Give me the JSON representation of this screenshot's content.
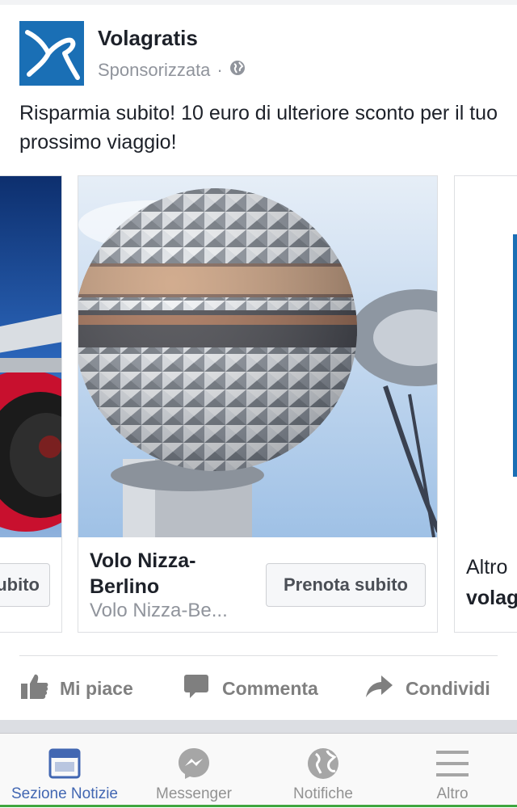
{
  "post": {
    "page_name": "Volagratis",
    "sponsored": "Sponsorizzata",
    "separator": "·",
    "text": "Risparmia subito! 10 euro di ulteriore sconto per il tuo prossimo viaggio!"
  },
  "carousel": {
    "left_card": {
      "cta": "ubito"
    },
    "main_card": {
      "title": "Volo Nizza-Berlino",
      "subtitle": "Volo Nizza-Be...",
      "cta": "Prenota subito"
    },
    "right_card": {
      "line1": "Altro",
      "line2": "volag"
    }
  },
  "actions": {
    "like": "Mi piace",
    "comment": "Commenta",
    "share": "Condividi"
  },
  "tabbar": {
    "tabs": [
      {
        "label": "Sezione Notizie",
        "icon": "news-feed-icon",
        "active": true
      },
      {
        "label": "Messenger",
        "icon": "messenger-icon",
        "active": false
      },
      {
        "label": "Notifiche",
        "icon": "globe-icon",
        "active": false
      },
      {
        "label": "Altro",
        "icon": "menu-icon",
        "active": false
      }
    ]
  },
  "colors": {
    "brand_blue": "#1a6fb5",
    "facebook_blue": "#4267b2",
    "grey_text": "#90949c",
    "action_grey": "#7f7f7f"
  }
}
